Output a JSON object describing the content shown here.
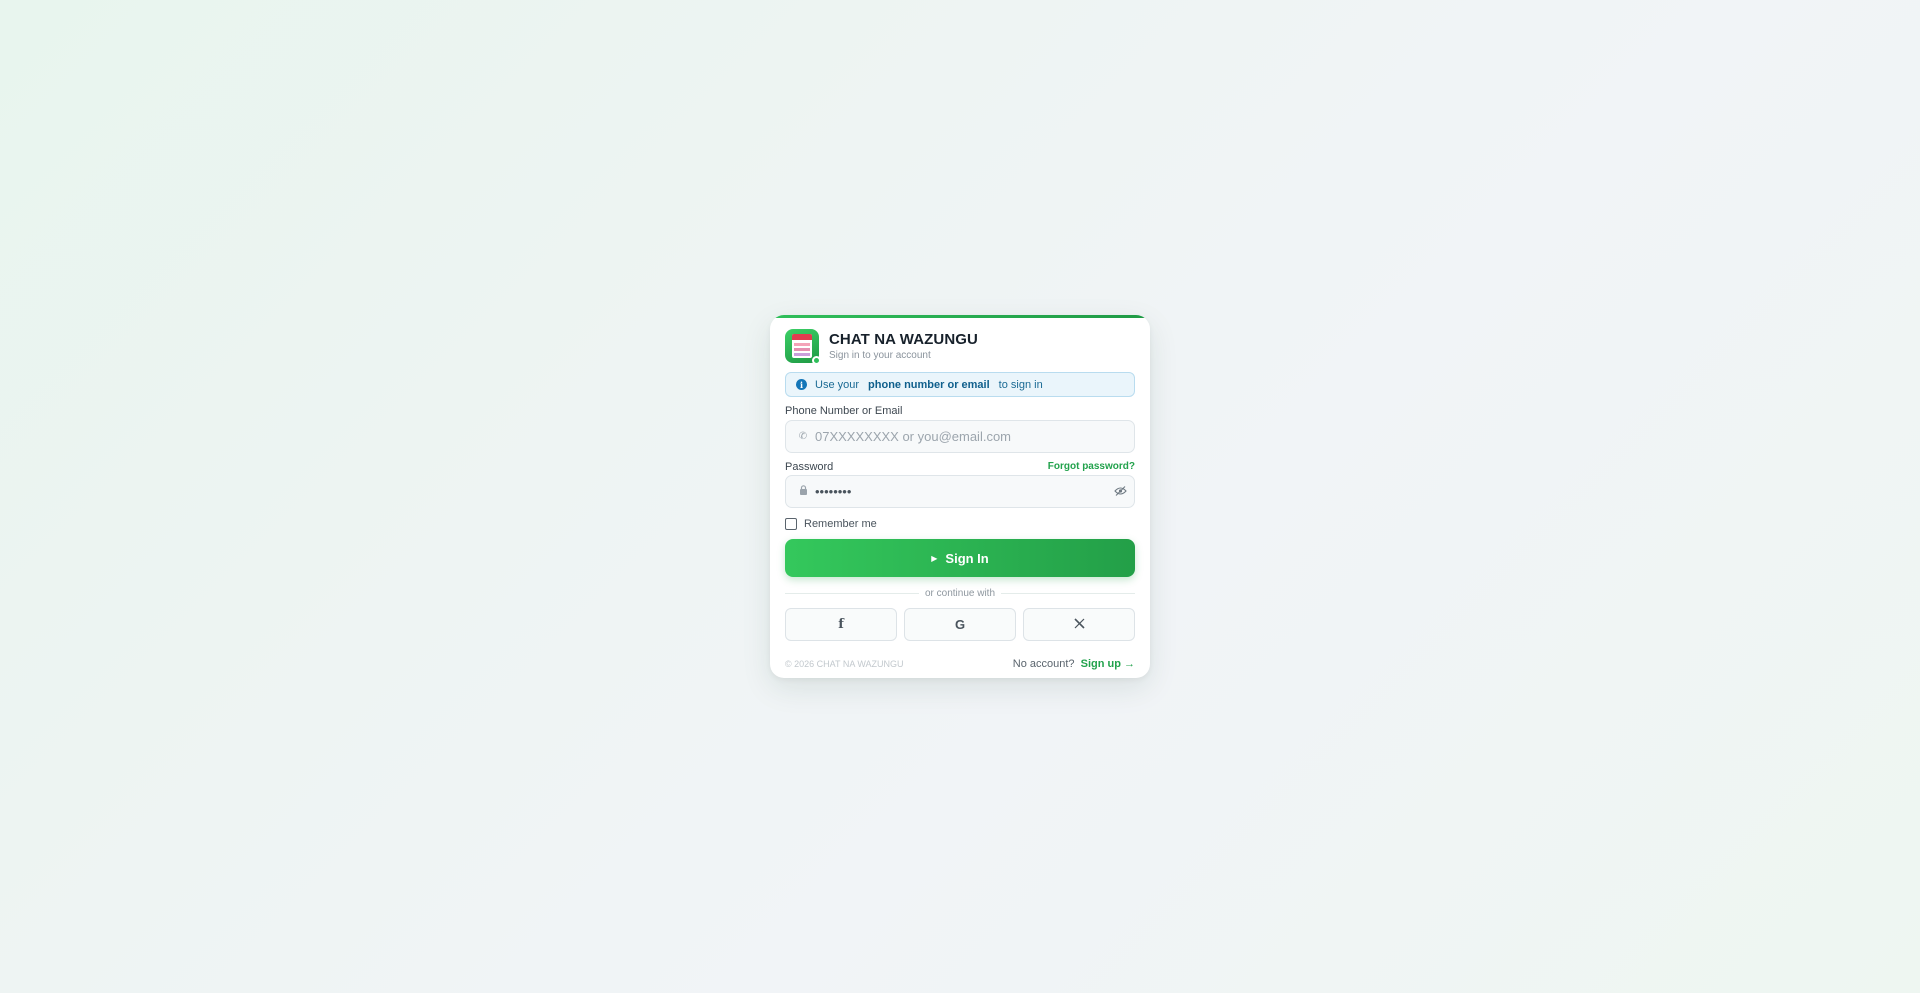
{
  "app": {
    "title": "CHAT NA WAZUNGU",
    "subtitle": "Sign in to your account"
  },
  "info": {
    "prefix": "Use your",
    "highlight": "phone number or email",
    "suffix": "to sign in",
    "icon": "info-icon"
  },
  "form": {
    "identifier_label": "Phone Number or Email",
    "identifier_placeholder": "07XXXXXXXX or you@email.com",
    "identifier_icon": "phone-icon",
    "password_label": "Password",
    "password_value": "password",
    "password_icon": "lock-icon",
    "forgot_label": "Forgot password?",
    "remember_label": "Remember me",
    "remember_checked": false,
    "submit_label": "Sign In"
  },
  "divider_label": "or continue with",
  "social": [
    {
      "name": "facebook",
      "glyph": "f"
    },
    {
      "name": "google",
      "glyph": "G"
    },
    {
      "name": "x",
      "glyph": "𝕏"
    }
  ],
  "footer": {
    "copyright": "© 2026 CHAT NA WAZUNGU",
    "no_account": "No account?",
    "signup_label": "Sign up →"
  },
  "colors": {
    "accent": "#22a24c",
    "accent_light": "#34c85c",
    "info_bg": "#eaf5fb",
    "info_text": "#1a6a94"
  }
}
